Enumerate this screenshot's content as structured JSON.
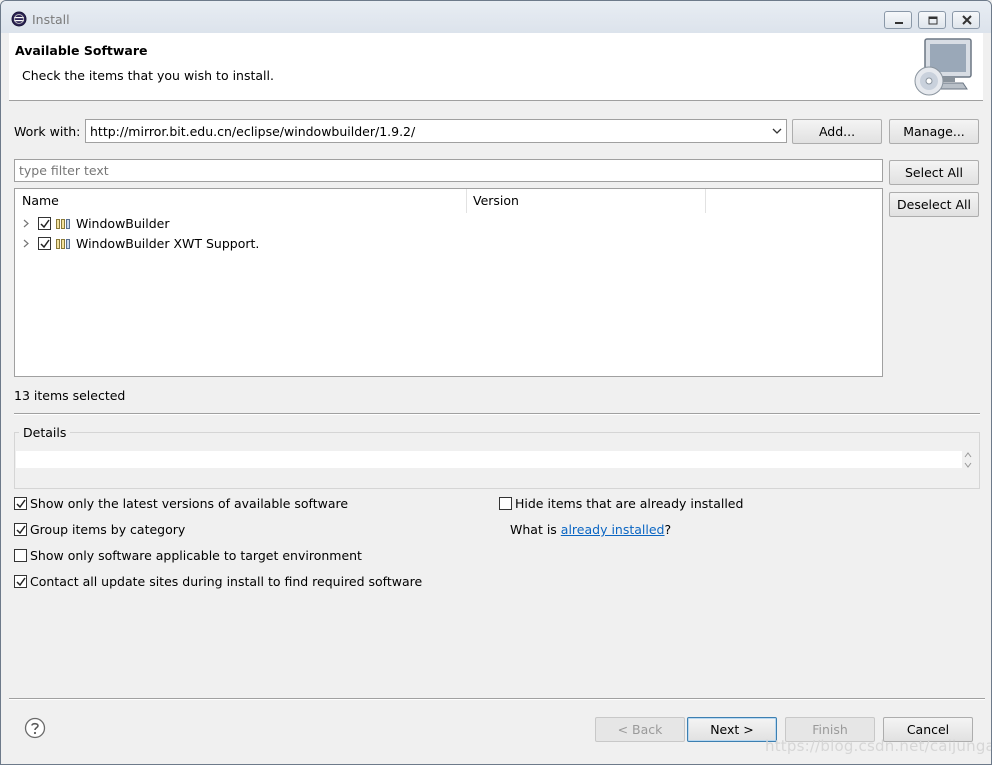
{
  "window": {
    "title": "Install"
  },
  "header": {
    "title": "Available Software",
    "subtitle": "Check the items that you wish to install."
  },
  "work_with": {
    "label": "Work with:",
    "value": "http://mirror.bit.edu.cn/eclipse/windowbuilder/1.9.2/",
    "add_label": "Add...",
    "manage_label": "Manage..."
  },
  "filter": {
    "placeholder": "type filter text"
  },
  "buttons": {
    "select_all": "Select All",
    "deselect_all": "Deselect All"
  },
  "tree": {
    "columns": [
      "Name",
      "Version"
    ],
    "items": [
      {
        "label": "WindowBuilder",
        "version": "",
        "checked": true
      },
      {
        "label": "WindowBuilder XWT Support.",
        "version": "",
        "checked": true
      }
    ]
  },
  "status": {
    "selected_text": "13 items selected"
  },
  "details": {
    "label": "Details",
    "text": ""
  },
  "options": {
    "latest_versions": {
      "label": "Show only the latest versions of available software",
      "checked": true
    },
    "group_by_category": {
      "label": "Group items by category",
      "checked": true
    },
    "target_env": {
      "label": "Show only software applicable to target environment",
      "checked": false
    },
    "contact_sites": {
      "label": "Contact all update sites during install to find required software",
      "checked": true
    },
    "hide_installed": {
      "label": "Hide items that are already installed",
      "checked": false
    },
    "what_is_prefix": "What is",
    "what_is_link": "already installed",
    "what_is_suffix": "?"
  },
  "footer": {
    "back": "< Back",
    "next": "Next >",
    "finish": "Finish",
    "cancel": "Cancel"
  },
  "watermark": "https://blog.csdn.net/caijungan"
}
